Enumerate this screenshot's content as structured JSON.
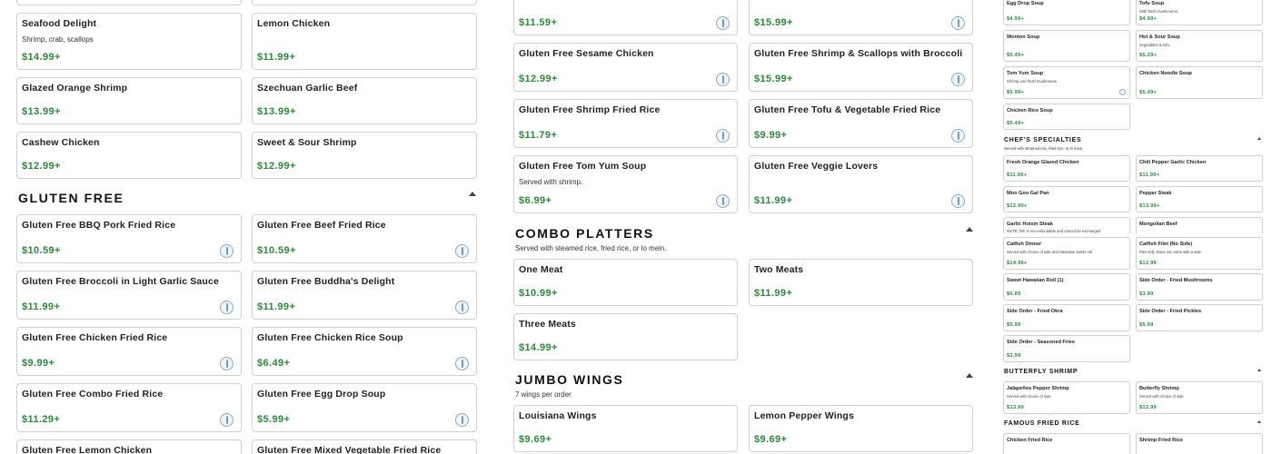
{
  "left_column": {
    "top_cards": [
      {
        "name": "Seafood Delight",
        "desc": "Shrimp, crab, scallops",
        "price": "$14.99+"
      },
      {
        "name": "Lemon Chicken",
        "desc": "",
        "price": "$11.99+"
      },
      {
        "name": "Glazed Orange Shrimp",
        "desc": "",
        "price": "$13.99+"
      },
      {
        "name": "Szechuan Garlic Beef",
        "desc": "",
        "price": "$13.99+"
      },
      {
        "name": "Cashew Chicken",
        "desc": "",
        "price": "$12.99+"
      },
      {
        "name": "Sweet & Sour Shrimp",
        "desc": "",
        "price": "$12.99+"
      }
    ],
    "gluten_free": {
      "title": "GLUTEN FREE",
      "items": [
        {
          "name": "Gluten Free BBQ Pork Fried Rice",
          "price": "$10.59+"
        },
        {
          "name": "Gluten Free Beef Fried Rice",
          "price": "$10.59+"
        },
        {
          "name": "Gluten Free Broccoli in Light Garlic Sauce",
          "price": "$11.99+"
        },
        {
          "name": "Gluten Free Buddha's Delight",
          "price": "$11.99+"
        },
        {
          "name": "Gluten Free Chicken Fried Rice",
          "price": "$9.99+"
        },
        {
          "name": "Gluten Free Chicken Rice Soup",
          "price": "$6.49+"
        },
        {
          "name": "Gluten Free Combo Fried Rice",
          "price": "$11.29+"
        },
        {
          "name": "Gluten Free Egg Drop Soup",
          "price": "$5.99+"
        },
        {
          "name": "Gluten Free Lemon Chicken",
          "price": ""
        },
        {
          "name": "Gluten Free Mixed Vegetable Fried Rice",
          "price": ""
        }
      ]
    }
  },
  "middle_column": {
    "gf_cards": [
      {
        "name": "",
        "desc": "",
        "price": "$11.59+"
      },
      {
        "name": "",
        "desc": "",
        "price": "$15.99+"
      },
      {
        "name": "Gluten Free Sesame Chicken",
        "desc": "",
        "price": "$12.99+"
      },
      {
        "name": "Gluten Free Shrimp & Scallops with Broccoli",
        "desc": "",
        "price": "$15.99+"
      },
      {
        "name": "Gluten Free Shrimp Fried Rice",
        "desc": "",
        "price": "$11.79+"
      },
      {
        "name": "Gluten Free Tofu & Vegetable Fried Rice",
        "desc": "",
        "price": "$9.99+"
      },
      {
        "name": "Gluten Free Tom Yum Soup",
        "desc": "Served with shrimp.",
        "price": "$6.99+"
      },
      {
        "name": "Gluten Free Veggie Lovers",
        "desc": "",
        "price": "$11.99+"
      }
    ],
    "combo": {
      "title": "COMBO PLATTERS",
      "subtitle": "Served with steamed rice, fried rice, or lo mein.",
      "items": [
        {
          "name": "One Meat",
          "price": "$10.99+"
        },
        {
          "name": "Two Meats",
          "price": "$11.99+"
        },
        {
          "name": "Three Meats",
          "price": "$14.99+"
        }
      ]
    },
    "wings": {
      "title": "JUMBO WINGS",
      "subtitle": "7 wings per order",
      "items": [
        {
          "name": "Louisiana Wings",
          "price": "$9.69+"
        },
        {
          "name": "Lemon Pepper Wings",
          "price": "$9.69+"
        }
      ]
    }
  },
  "right_column": {
    "soups": [
      {
        "name": "Egg Drop Soup",
        "desc": "",
        "price": "$4.99+"
      },
      {
        "name": "Tofu Soup",
        "desc": "With fresh mushrooms.",
        "price": "$4.99+"
      },
      {
        "name": "Wonton Soup",
        "desc": "",
        "price": "$5.49+"
      },
      {
        "name": "Hot & Sour Soup",
        "desc": "Vegetables & tofu.",
        "price": "$5.29+"
      },
      {
        "name": "Tom Yum Soup",
        "desc": "Shrimp and fresh mushrooms.",
        "price": "$5.99+"
      },
      {
        "name": "Chicken Noodle Soup",
        "desc": "",
        "price": "$5.49+"
      },
      {
        "name": "Chicken Rice Soup",
        "desc": "",
        "price": "$5.49+"
      }
    ],
    "chefs": {
      "title": "CHEF'S SPECIALTIES",
      "subtitle": "Served with steamed rice, fried rice, or lo mein.",
      "items": [
        {
          "name": "Fresh Orange Glazed Chicken",
          "desc": "",
          "price": "$11.99+"
        },
        {
          "name": "Chili Pepper Garlic Chicken",
          "desc": "",
          "price": "$11.99+"
        },
        {
          "name": "Moo Goo Gai Pan",
          "desc": "",
          "price": "$12.99+"
        },
        {
          "name": "Pepper Steak",
          "desc": "",
          "price": "$13.99+"
        },
        {
          "name": "Garlic Hoisin Steak",
          "desc": "NOTE: fish is non-refundable and cannot be exchanged",
          "price": ""
        },
        {
          "name": "Mongolian Beef",
          "desc": "",
          "price": ""
        },
        {
          "name": "Catfish Dinner",
          "desc": "Served with choice of side and Hawaiian sweet roll.",
          "price": "$14.99+"
        },
        {
          "name": "Catfish Filet (No Side)",
          "desc": "Filet only. Does not come with a side.",
          "price": "$12.99"
        },
        {
          "name": "Sweet Hawaiian Roll (1)",
          "desc": "",
          "price": "$0.89"
        },
        {
          "name": "Side Order -  Fried Mushrooms",
          "desc": "",
          "price": "$3.99"
        },
        {
          "name": "Side Order -  Fried Okra",
          "desc": "",
          "price": "$5.99"
        },
        {
          "name": "Side Order - Fried Pickles",
          "desc": "",
          "price": "$5.99"
        },
        {
          "name": "Side Order -  Seasoned Fries",
          "desc": "",
          "price": "$3.99"
        }
      ]
    },
    "butterfly": {
      "title": "BUTTERFLY SHRIMP",
      "items": [
        {
          "name": "Jalapeños Pepper Shrimp",
          "desc": "Served with choice of side",
          "price": "$13.99"
        },
        {
          "name": "Butterfly Shrimp",
          "desc": "Served with choice of side",
          "price": "$12.99"
        }
      ]
    },
    "fried_rice": {
      "title": "FAMOUS FRIED RICE",
      "items": [
        {
          "name": "Chicken Fried Rice",
          "desc": "",
          "price": ""
        },
        {
          "name": "Shrimp Fried Rice",
          "desc": "",
          "price": ""
        }
      ]
    }
  }
}
